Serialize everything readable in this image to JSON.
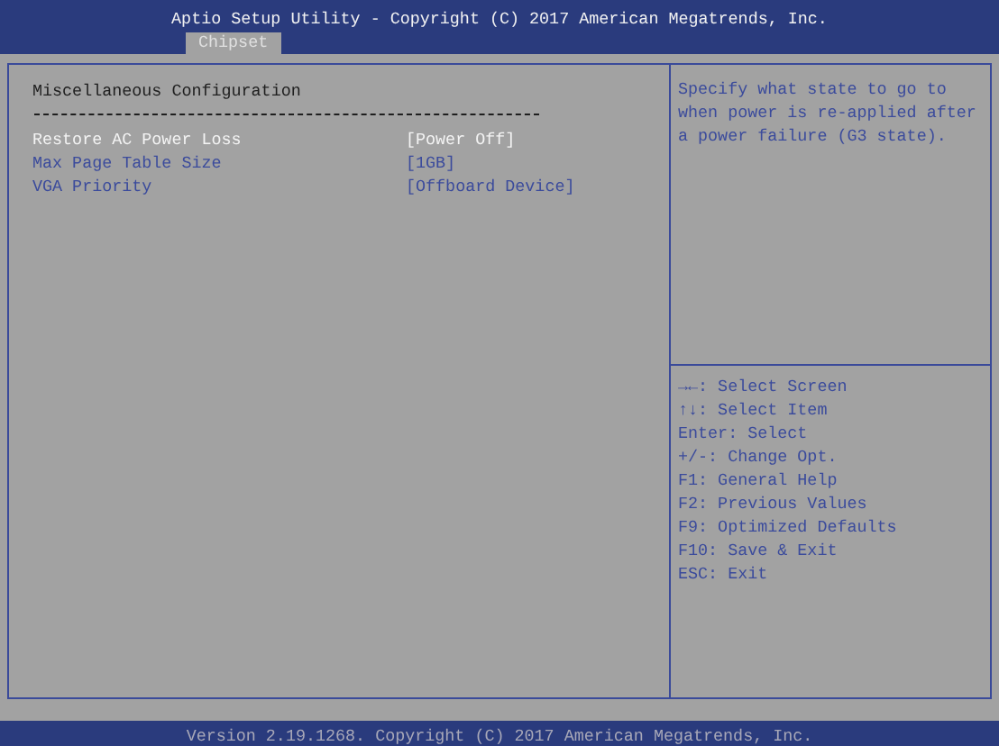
{
  "window": {
    "title": "Aptio Setup Utility - Copyright (C) 2017 American Megatrends, Inc."
  },
  "tabs": [
    {
      "label": "Chipset",
      "selected": true
    }
  ],
  "section_title": "Miscellaneous Configuration",
  "items": [
    {
      "label": "Restore AC Power Loss",
      "value": "[Power Off]",
      "selected": true
    },
    {
      "label": "Max Page Table Size",
      "value": "[1GB]",
      "selected": false
    },
    {
      "label": "VGA Priority",
      "value": "[Offboard Device]",
      "selected": false
    }
  ],
  "help_text": "Specify what state to go to when power is re-applied after a power failure (G3 state).",
  "key_help": [
    "→←: Select Screen",
    "↑↓: Select Item",
    "Enter: Select",
    "+/-: Change Opt.",
    "F1: General Help",
    "F2: Previous Values",
    "F9: Optimized Defaults",
    "F10: Save & Exit",
    "ESC: Exit"
  ],
  "status_bar": "Version 2.19.1268. Copyright (C) 2017 American Megatrends, Inc."
}
